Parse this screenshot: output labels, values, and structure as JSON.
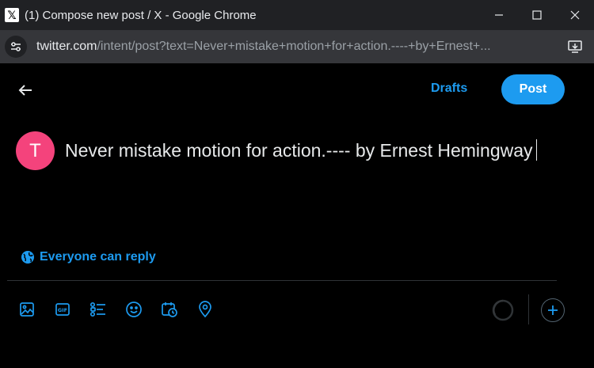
{
  "window": {
    "title": "(1) Compose new post / X - Google Chrome",
    "favicon": "x-logo-icon",
    "controls": [
      "minimize-icon",
      "maximize-icon",
      "close-icon"
    ]
  },
  "address_bar": {
    "host": "twitter.com",
    "path": "/intent/post?text=Never+mistake+motion+for+action.----+by+Ernest+..."
  },
  "header": {
    "back_icon": "back-arrow-icon",
    "drafts_label": "Drafts",
    "post_label": "Post"
  },
  "composer": {
    "avatar_initial": "T",
    "text": "Never mistake motion for action.---- by Ernest Hemingway"
  },
  "reply_setting": {
    "icon": "globe-icon",
    "label": "Everyone can reply"
  },
  "toolbar": {
    "tools": [
      "media-icon",
      "gif-icon",
      "poll-icon",
      "emoji-icon",
      "schedule-icon",
      "location-icon"
    ],
    "progress_icon": "character-count-ring",
    "add_icon": "plus-icon"
  },
  "colors": {
    "accent": "#1d9bf0",
    "avatar": "#f4437c",
    "background": "#000000",
    "titlebar": "#202124",
    "addressbar": "#35363a"
  }
}
